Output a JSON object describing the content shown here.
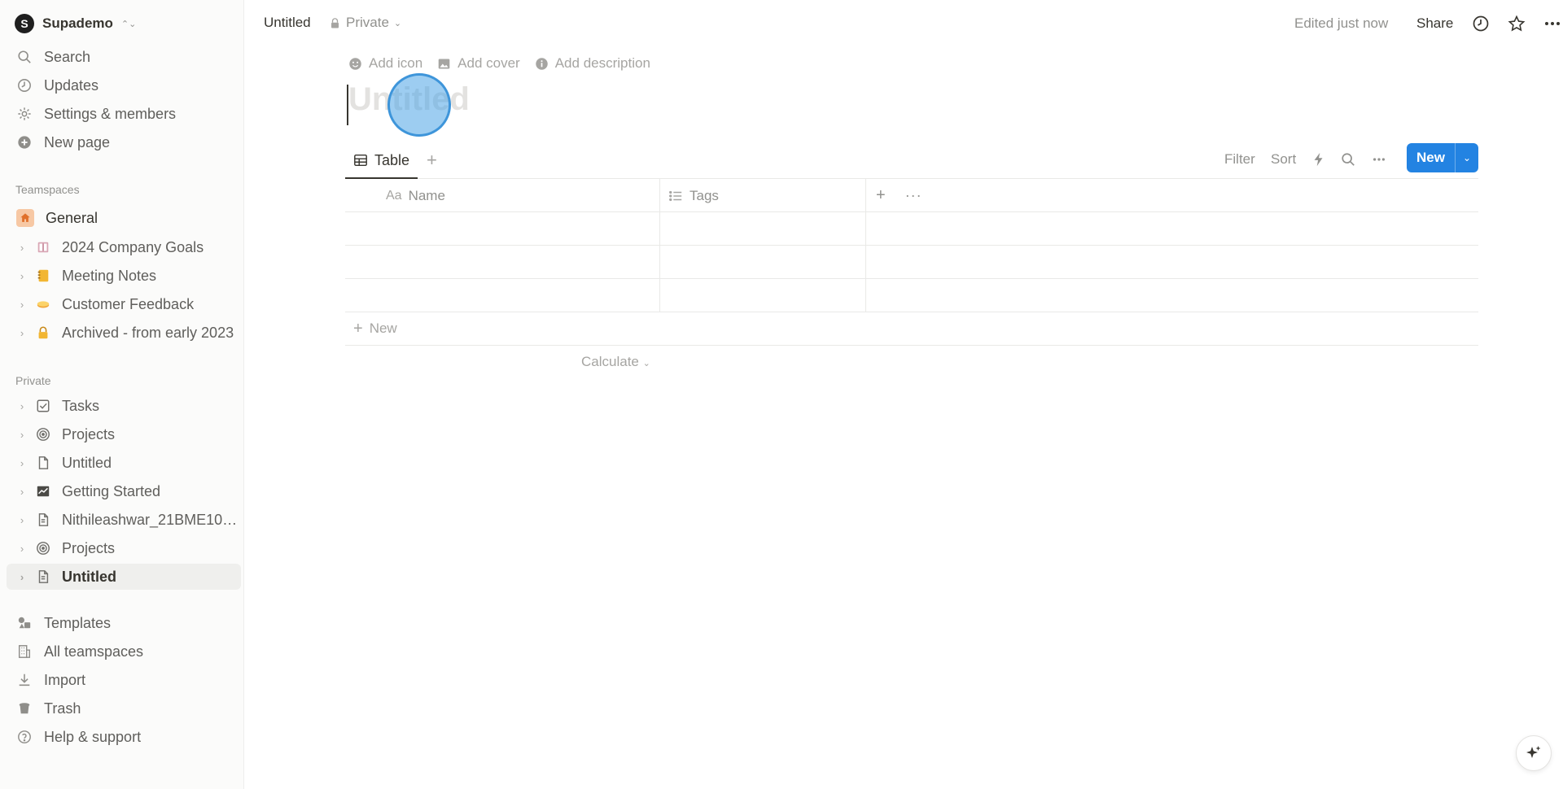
{
  "workspace": {
    "avatar_letter": "S",
    "name": "Supademo"
  },
  "sidebar": {
    "nav": [
      {
        "label": "Search",
        "icon": "search-icon"
      },
      {
        "label": "Updates",
        "icon": "clock-icon"
      },
      {
        "label": "Settings & members",
        "icon": "gear-icon"
      },
      {
        "label": "New page",
        "icon": "plus-circle-icon"
      }
    ],
    "teamspaces_label": "Teamspaces",
    "general_label": "General",
    "teamspace_pages": [
      {
        "label": "2024 Company Goals",
        "icon": "book-icon"
      },
      {
        "label": "Meeting Notes",
        "icon": "notebook-icon"
      },
      {
        "label": "Customer Feedback",
        "icon": "pie-icon"
      },
      {
        "label": "Archived - from early 2023",
        "icon": "lock-icon"
      }
    ],
    "private_label": "Private",
    "private_pages": [
      {
        "label": "Tasks",
        "icon": "checkbox-icon"
      },
      {
        "label": "Projects",
        "icon": "target-icon"
      },
      {
        "label": "Untitled",
        "icon": "document-icon"
      },
      {
        "label": "Getting Started",
        "icon": "chart-icon"
      },
      {
        "label": "Nithileashwar_21BME103...",
        "icon": "document-icon"
      },
      {
        "label": "Projects",
        "icon": "target-icon"
      },
      {
        "label": "Untitled",
        "icon": "document-icon",
        "active": true
      }
    ],
    "bottom": [
      {
        "label": "Templates",
        "icon": "shapes-icon"
      },
      {
        "label": "All teamspaces",
        "icon": "building-icon"
      },
      {
        "label": "Import",
        "icon": "download-icon"
      },
      {
        "label": "Trash",
        "icon": "trash-icon"
      },
      {
        "label": "Help & support",
        "icon": "help-icon"
      }
    ]
  },
  "topbar": {
    "breadcrumb": "Untitled",
    "privacy": "Private",
    "edited": "Edited just now",
    "share": "Share"
  },
  "page": {
    "add_icon": "Add icon",
    "add_cover": "Add cover",
    "add_description": "Add description",
    "title_placeholder": "Untitled"
  },
  "database": {
    "view_tab": "Table",
    "filter": "Filter",
    "sort": "Sort",
    "new_button": "New",
    "columns": [
      {
        "prefix": "Aa",
        "label": "Name"
      },
      {
        "label": "Tags"
      }
    ],
    "empty_rows": 3,
    "new_row": "New",
    "calculate": "Calculate"
  },
  "colors": {
    "accent": "#2383e2",
    "general_badge": "#f7c8a4",
    "click_highlight": "#4ca4e6"
  }
}
